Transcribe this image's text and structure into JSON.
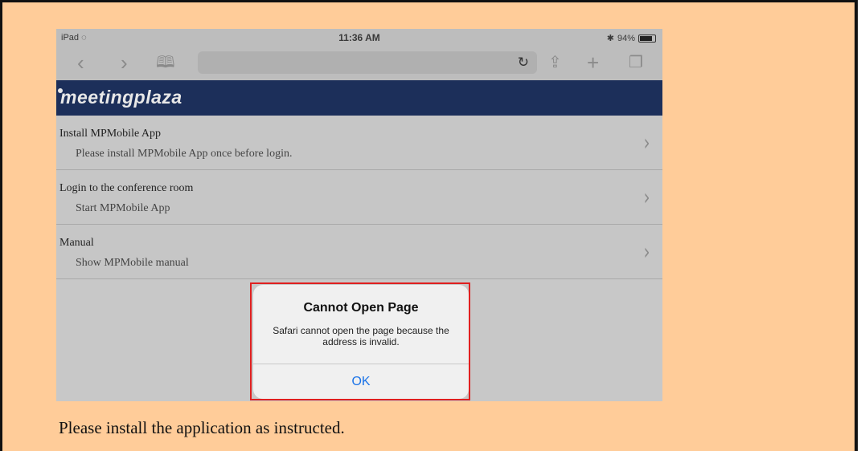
{
  "status_bar": {
    "device": "iPad",
    "time": "11:36 AM",
    "battery": "94%",
    "battery_level": 0.94
  },
  "toolbar": {
    "back_icon": "chevron-left-icon",
    "forward_icon": "chevron-right-icon",
    "bookmarks_icon": "book-icon",
    "reload_icon": "reload-icon",
    "share_icon": "share-icon",
    "add_icon": "plus-icon",
    "tabs_icon": "tabs-icon"
  },
  "site": {
    "logo": "meetingplaza",
    "header_color": "#1c2f5a"
  },
  "menu": {
    "items": [
      {
        "title": "Install MPMobile App",
        "subtitle": "Please install MPMobile App once before login."
      },
      {
        "title": "Login to the conference room",
        "subtitle": "Start MPMobile App"
      },
      {
        "title": "Manual",
        "subtitle": "Show MPMobile manual"
      }
    ]
  },
  "dialog": {
    "title": "Cannot Open Page",
    "message": "Safari cannot open the page because the address is invalid.",
    "ok_label": "OK",
    "highlight_color": "#e02020"
  },
  "caption": "Please install the application as instructed."
}
